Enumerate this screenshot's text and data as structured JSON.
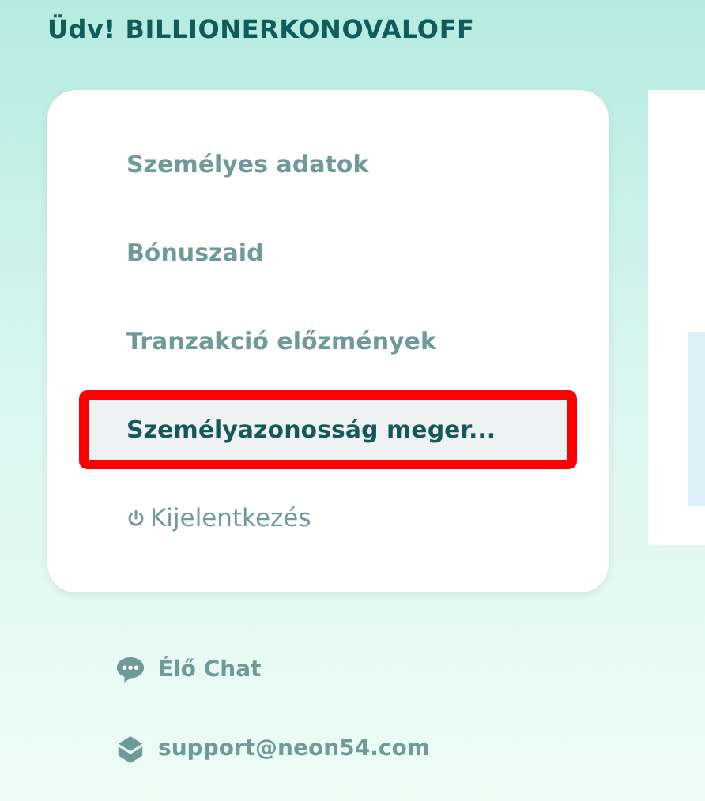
{
  "greeting": "Üdv! BILLIONERKONOVALOFF",
  "menu": [
    {
      "label": "Személyes adatok",
      "kind": "link",
      "selected": false,
      "outlined": false
    },
    {
      "label": "Bónuszaid",
      "kind": "link",
      "selected": false,
      "outlined": false
    },
    {
      "label": "Tranzakció előzmények",
      "kind": "link",
      "selected": false,
      "outlined": false
    },
    {
      "label": "Személyazonosság meger...",
      "kind": "link",
      "selected": true,
      "outlined": true
    },
    {
      "label": "Kijelentkezés",
      "kind": "logout",
      "selected": false,
      "outlined": false
    }
  ],
  "contacts": [
    {
      "label": "Élő Chat",
      "kind": "chat"
    },
    {
      "label": "support@neon54.com",
      "kind": "email"
    }
  ]
}
